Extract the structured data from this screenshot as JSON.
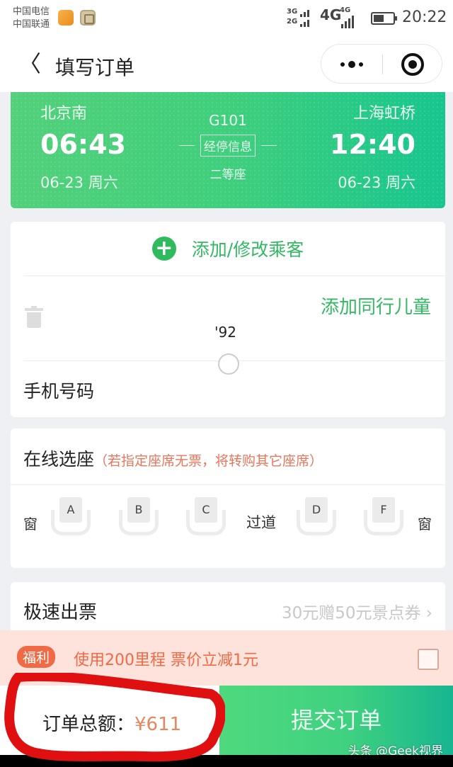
{
  "status_bar": {
    "carrier_1": "中国电信",
    "carrier_2": "中国联通",
    "net_top": "3G",
    "net_bottom": "2G",
    "net_4g": "4G",
    "net_4g_small": "4G",
    "time": "20:22"
  },
  "nav": {
    "back_icon": "chevron-left",
    "back_glyph": "〈",
    "title": "填写订单",
    "more_icon": "more-dots",
    "close_icon": "target-circle"
  },
  "train": {
    "from_station": "北京南",
    "from_time": "06:43",
    "from_date": "06-23  周六",
    "to_station": "上海虹桥",
    "to_time": "12:40",
    "to_date": "06-23  周六",
    "train_no": "G101",
    "stops_label": "经停信息",
    "seat_class": "二等座",
    "gradient_start": "#52d07a",
    "gradient_end": "#17c58e"
  },
  "passenger": {
    "add_label": "添加/修改乘客",
    "add_icon": "plus-circle",
    "delete_icon": "trash",
    "name_masked": "",
    "id_partial": "'92",
    "add_child_label": "添加同行儿童",
    "phone_label": "手机号码",
    "phone_value_masked": ""
  },
  "seat_selection": {
    "title": "在线选座",
    "note": "（若指定座席无票，将转购其它座席）",
    "window_left": "窗",
    "window_right": "窗",
    "aisle": "过道",
    "seats": [
      "A",
      "B",
      "C",
      "D",
      "F"
    ]
  },
  "express": {
    "label": "极速出票",
    "value": "30元赠50元景点券",
    "chevron": "›"
  },
  "welfare": {
    "badge": "福利",
    "text": "使用200里程 票价立减1元",
    "checked": false
  },
  "footer": {
    "total_label": "订单总额：",
    "total_amount": "¥611",
    "submit_label": "提交订单",
    "watermark": "头条 @Geek视界"
  },
  "colors": {
    "accent_green": "#33b864",
    "price_orange": "#e8855e",
    "welfare_red": "#ef6a45",
    "annotation_red": "#e01010"
  }
}
